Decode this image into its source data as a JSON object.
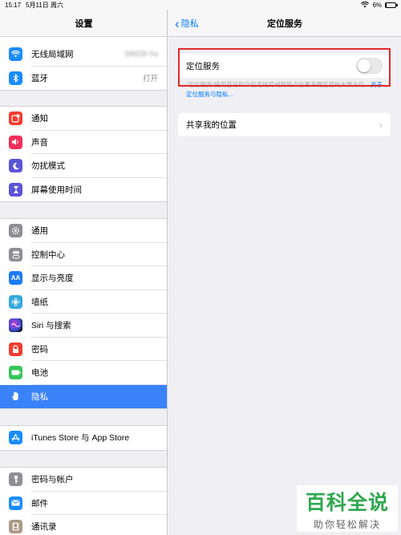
{
  "status": {
    "time": "15:17",
    "date": "5月11日 周六",
    "battery": "6%",
    "battery_level": 0.06
  },
  "sidebar": {
    "title": "设置",
    "items": [
      {
        "label": "无线局域网",
        "value": "DACD-Yu",
        "icon": "wifi-icon",
        "color": "#1a8cff"
      },
      {
        "label": "蓝牙",
        "value": "打开",
        "icon": "bluetooth-icon",
        "color": "#1a8cff"
      },
      {
        "label": "通知",
        "icon": "notification-icon",
        "color": "#f23b30"
      },
      {
        "label": "声音",
        "icon": "sound-icon",
        "color": "#f2305a"
      },
      {
        "label": "勿扰模式",
        "icon": "moon-icon",
        "color": "#5b55d6"
      },
      {
        "label": "屏幕使用时间",
        "icon": "hourglass-icon",
        "color": "#5b55d6"
      },
      {
        "label": "通用",
        "icon": "gear-icon",
        "color": "#8e8e93"
      },
      {
        "label": "控制中心",
        "icon": "control-center-icon",
        "color": "#8e8e93"
      },
      {
        "label": "显示与亮度",
        "icon": "display-icon",
        "color": "#1a7cf5"
      },
      {
        "label": "墙纸",
        "icon": "wallpaper-icon",
        "color": "#35aadc"
      },
      {
        "label": "Siri 与搜索",
        "icon": "siri-icon",
        "color": "#222233"
      },
      {
        "label": "密码",
        "icon": "lock-icon",
        "color": "#f23b30"
      },
      {
        "label": "电池",
        "icon": "battery-icon",
        "color": "#34c759"
      },
      {
        "label": "隐私",
        "icon": "hand-icon",
        "color": "#3a82f7"
      },
      {
        "label": "iTunes Store 与 App Store",
        "icon": "app-store-icon",
        "color": "#1a8cff"
      },
      {
        "label": "密码与帐户",
        "icon": "key-icon",
        "color": "#8e8e93"
      },
      {
        "label": "邮件",
        "icon": "mail-icon",
        "color": "#1a8cff"
      },
      {
        "label": "通讯录",
        "icon": "contacts-icon",
        "color": "#a89a86"
      }
    ]
  },
  "main": {
    "back_label": "隐私",
    "title": "定位服务",
    "location_services_label": "定位服务",
    "location_services_on": false,
    "description": "“定位服务”使用蓝牙和众包无线局域网热点位置来确定您的大致方位。",
    "description_link": "关于定位服务与隐私…",
    "share_location_label": "共享我的位置"
  },
  "watermark": {
    "title": "百科全说",
    "subtitle": "助你轻松解决"
  },
  "colors": {
    "accent": "#007aff",
    "selected": "#3a82f7",
    "highlight_box": "#e02a2a"
  }
}
